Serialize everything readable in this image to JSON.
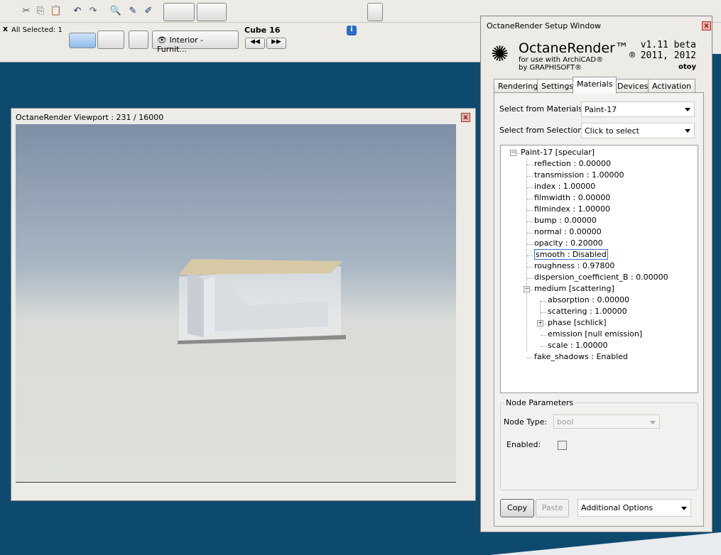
{
  "toolbar": {
    "selection_label": "All Selected: 1",
    "layer_button": "Interior - Furnit...",
    "element_name": "Cube 16"
  },
  "viewport": {
    "title": "OctaneRender Viewport : 231  / 16000"
  },
  "setup": {
    "title": "OctaneRender Setup Window",
    "brand": "OctaneRender™",
    "subtitle1": "for use with ArchiCAD®",
    "subtitle2": "by GRAPHISOFT®",
    "version": "v1.11 beta",
    "copyright": "® 2011, 2012",
    "otoy": "otoy",
    "tabs": [
      {
        "label": "Rendering"
      },
      {
        "label": "Settings"
      },
      {
        "label": "Materials",
        "active": true
      },
      {
        "label": "Devices"
      },
      {
        "label": "Activation"
      }
    ],
    "materials_label": "Select from Materials:",
    "materials_value": "Paint-17",
    "selection_label": "Select from Selection:",
    "selection_value": "Click to select",
    "tree": [
      {
        "label": "Paint-17  [specular]",
        "level": 0,
        "expander": "minus"
      },
      {
        "label": "reflection : 0.00000",
        "level": 1
      },
      {
        "label": "transmission : 1.00000",
        "level": 1
      },
      {
        "label": "index : 1.00000",
        "level": 1
      },
      {
        "label": "filmwidth : 0.00000",
        "level": 1
      },
      {
        "label": "filmindex : 1.00000",
        "level": 1
      },
      {
        "label": "bump : 0.00000",
        "level": 1
      },
      {
        "label": "normal : 0.00000",
        "level": 1
      },
      {
        "label": "opacity : 0.20000",
        "level": 1
      },
      {
        "label": "smooth : Disabled",
        "level": 1,
        "selected": true
      },
      {
        "label": "roughness : 0.97800",
        "level": 1
      },
      {
        "label": "dispersion_coefficient_B : 0.00000",
        "level": 1
      },
      {
        "label": "medium  [scattering]",
        "level": 1,
        "expander": "minus"
      },
      {
        "label": "absorption : 0.00000",
        "level": 2
      },
      {
        "label": "scattering : 1.00000",
        "level": 2
      },
      {
        "label": "phase  [schlick]",
        "level": 2,
        "expander": "plus"
      },
      {
        "label": "emission  [null emission]",
        "level": 2
      },
      {
        "label": "scale : 1.00000",
        "level": 2
      },
      {
        "label": "fake_shadows : Enabled",
        "level": 1
      }
    ],
    "node_params": {
      "group_label": "Node Parameters",
      "node_type_label": "Node Type:",
      "node_type_value": "bool",
      "enabled_label": "Enabled:",
      "enabled": false
    },
    "copy_label": "Copy",
    "paste_label": "Paste",
    "options_label": "Additional Options"
  }
}
